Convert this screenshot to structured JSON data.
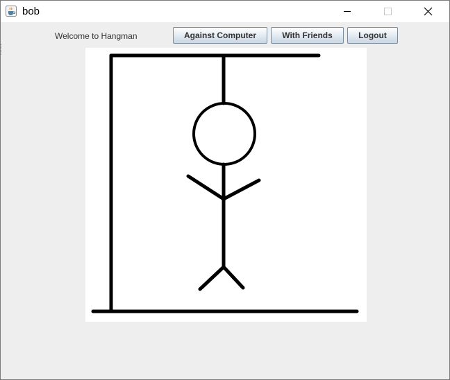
{
  "window": {
    "title": "bob",
    "icon": "java-cup-icon",
    "controls": [
      "minimize-icon",
      "maximize-icon",
      "close-icon"
    ]
  },
  "toolbar": {
    "welcome_text": "Welcome to Hangman",
    "against_computer_label": "Against Computer",
    "with_friends_label": "With Friends",
    "logout_label": "Logout"
  },
  "hangman": {
    "parts_drawn": [
      "base",
      "pole",
      "beam",
      "rope",
      "head",
      "body",
      "left-arm",
      "right-arm",
      "left-leg",
      "right-leg"
    ],
    "stroke_color": "#000000"
  },
  "colors": {
    "background": "#eeeeee",
    "titlebar": "#ffffff",
    "canvas": "#ffffff"
  }
}
